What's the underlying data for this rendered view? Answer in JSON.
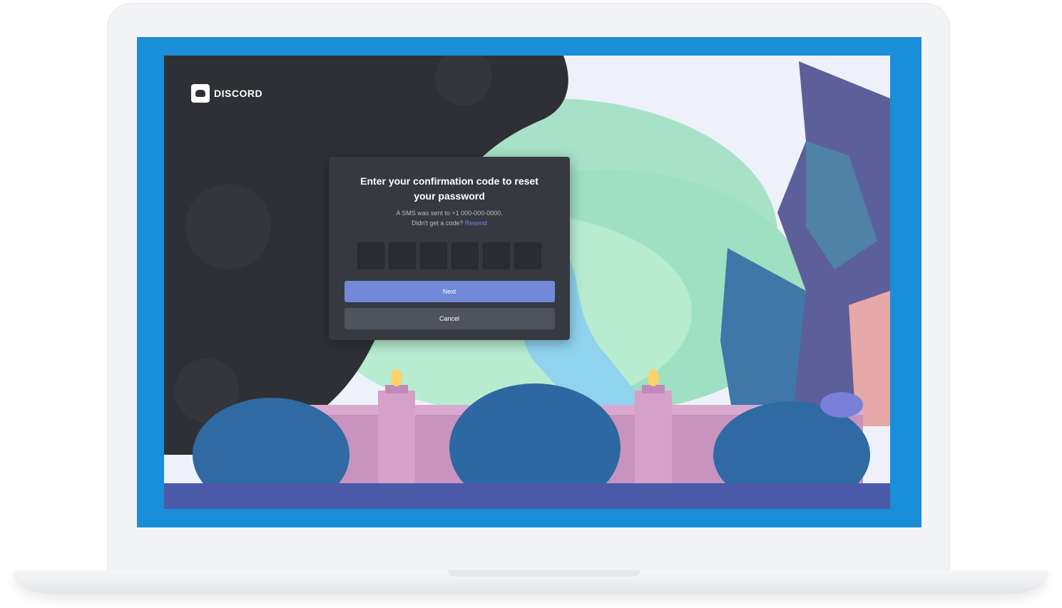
{
  "logo": {
    "wordmark": "DISCORD"
  },
  "modal": {
    "title": "Enter your confirmation code to reset your password",
    "sent_to": "A SMS was sent to +1 000-000-0000.",
    "no_code_prompt": "Didn't get a code?",
    "resend_link": "Resend",
    "code_length": 6,
    "next_label": "Next",
    "cancel_label": "Cancel"
  },
  "colors": {
    "screen_border": "#1a8ed8",
    "modal_bg": "#36393f",
    "primary_button": "#7289da",
    "secondary_button": "#4f545c",
    "link": "#7289da"
  },
  "icons": [
    "discord-logo-icon"
  ]
}
